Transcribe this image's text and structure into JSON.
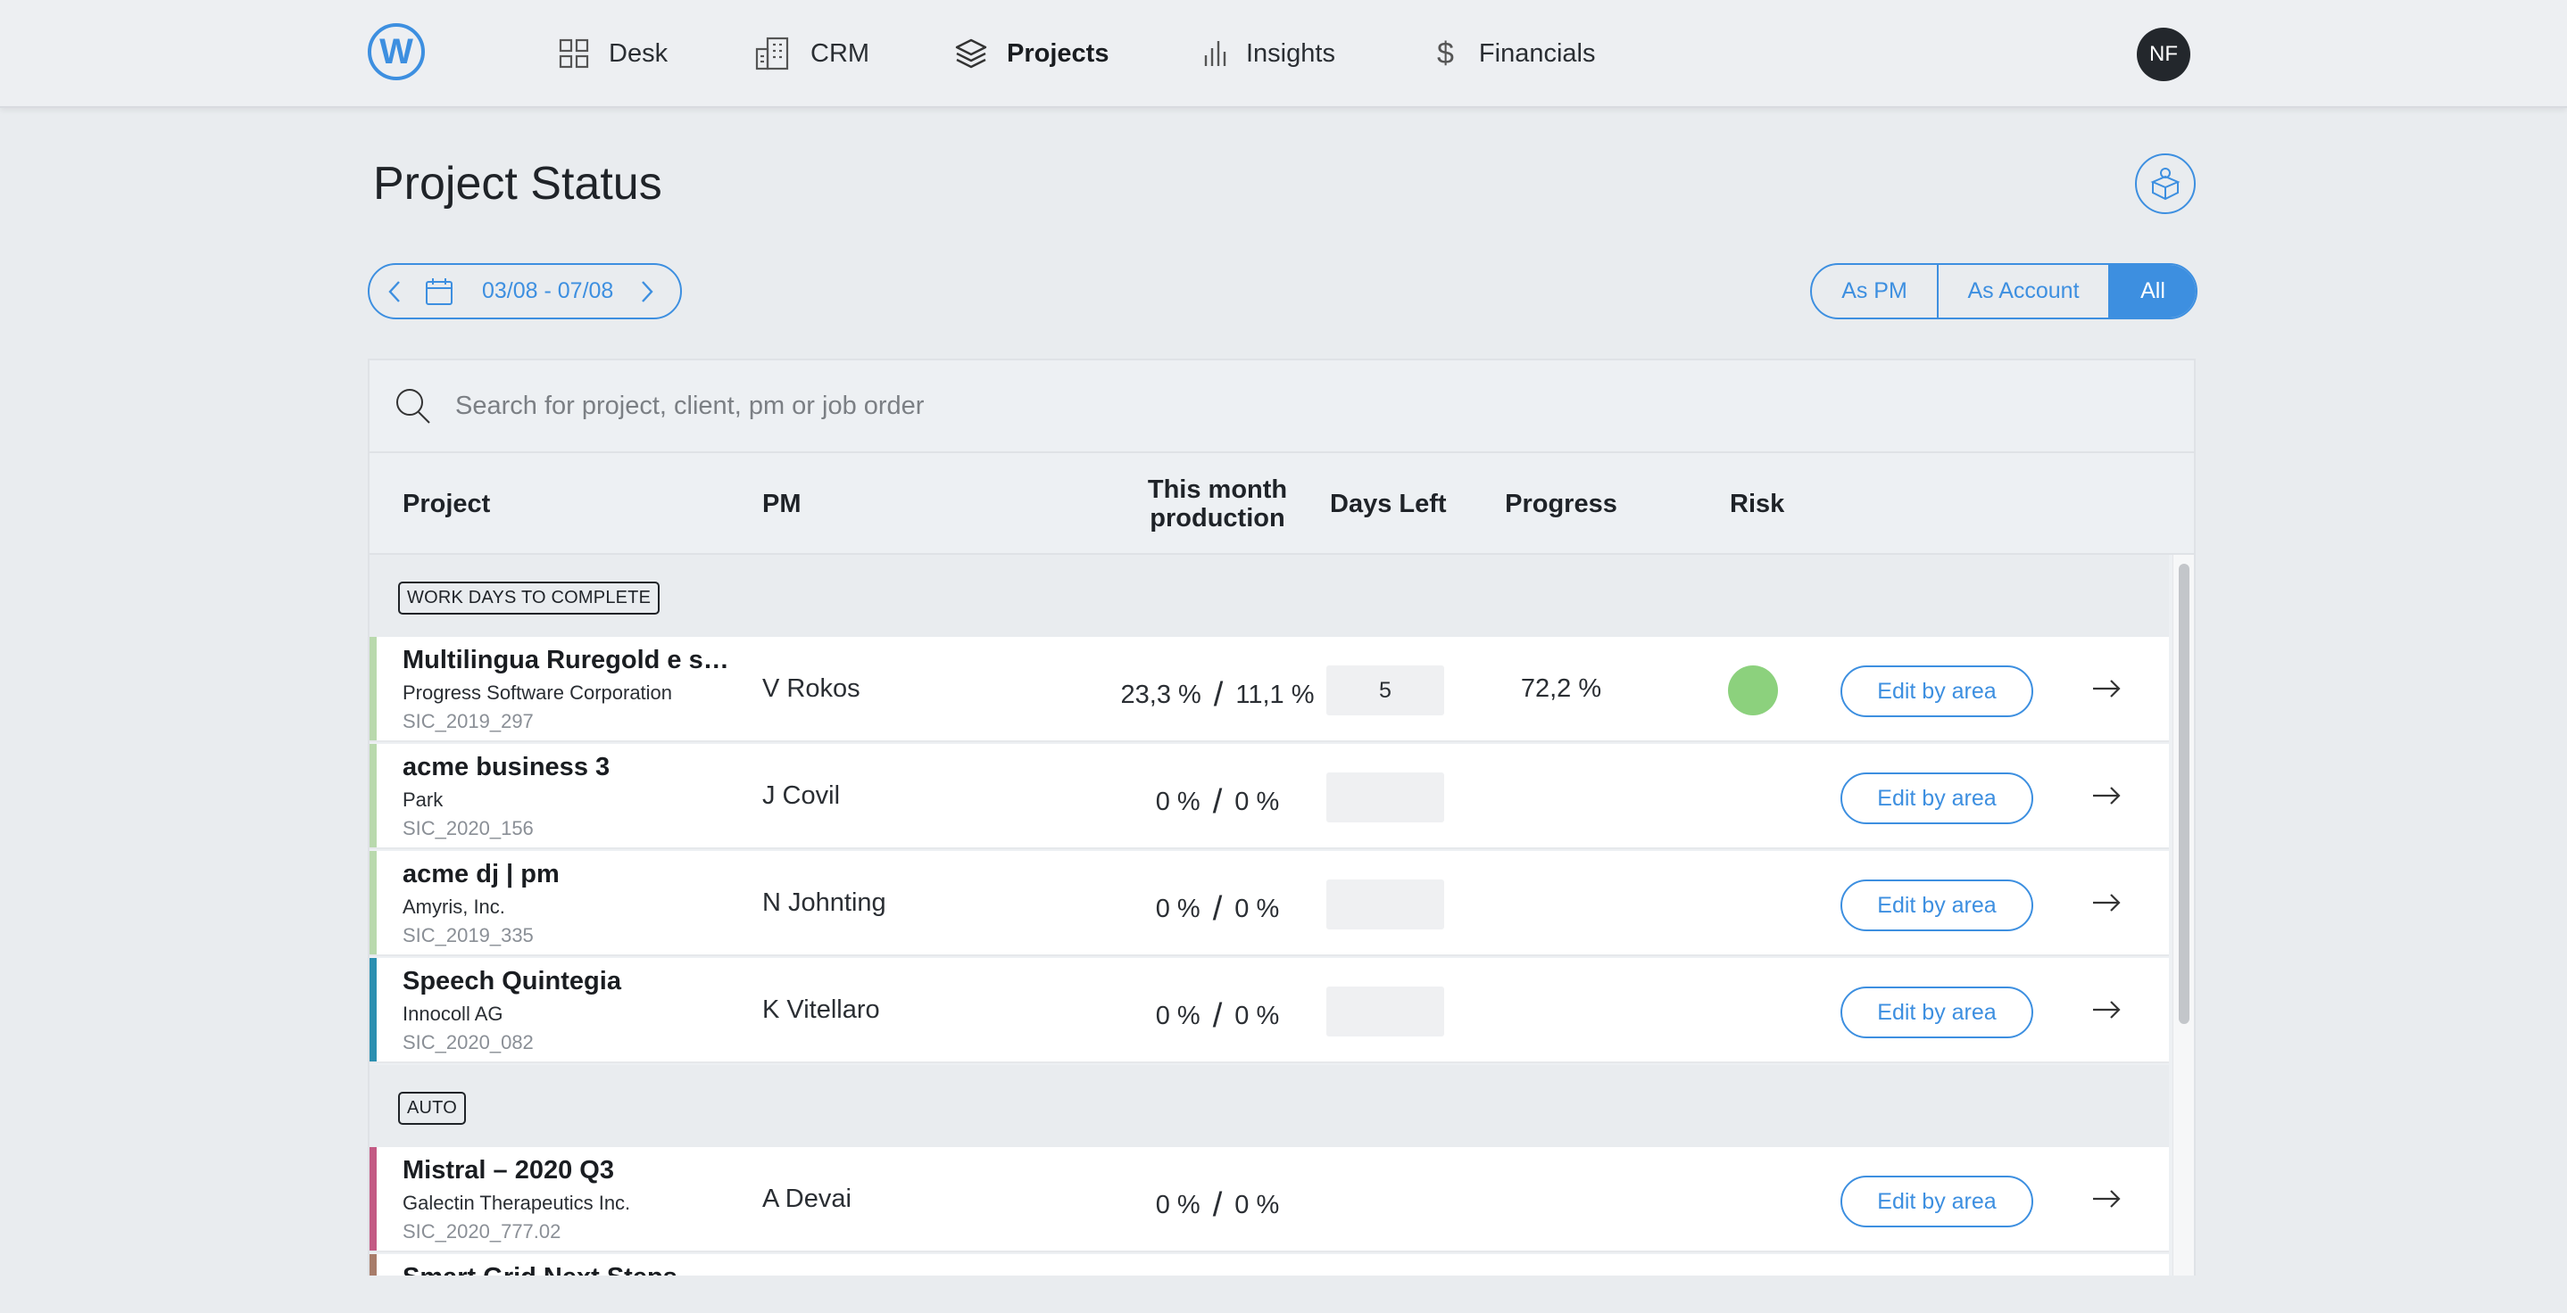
{
  "nav": {
    "logo_letter": "W",
    "items": [
      {
        "label": "Desk",
        "icon": "grid-icon",
        "active": false
      },
      {
        "label": "CRM",
        "icon": "building-icon",
        "active": false
      },
      {
        "label": "Projects",
        "icon": "layers-icon",
        "active": true
      },
      {
        "label": "Insights",
        "icon": "bar-chart-icon",
        "active": false
      },
      {
        "label": "Financials",
        "icon": "dollar-icon",
        "active": false
      }
    ],
    "avatar_initials": "NF"
  },
  "page": {
    "title": "Project Status",
    "date_range": "03/08 - 07/08",
    "filters": [
      {
        "label": "As PM",
        "active": false
      },
      {
        "label": "As Account",
        "active": false
      },
      {
        "label": "All",
        "active": true
      }
    ]
  },
  "search": {
    "placeholder": "Search for project, client, pm or job order"
  },
  "table": {
    "columns": {
      "project": "Project",
      "pm": "PM",
      "production_line1": "This month",
      "production_line2": "production",
      "days_left": "Days Left",
      "progress": "Progress",
      "risk": "Risk"
    },
    "groups": [
      {
        "tag": "WORK DAYS TO COMPLETE",
        "rows": [
          {
            "project": "Multilingua Ruregold e su...",
            "client": "Progress Software Corporation",
            "code": "SIC_2019_297",
            "pm": "V Rokos",
            "prod_a": "23,3 %",
            "prod_b": "11,1 %",
            "days_left": "5",
            "progress": "72,2 %",
            "risk_color": "#8cd17d",
            "bar_color": "#b9d9ad",
            "action": "Edit by area"
          },
          {
            "project": "acme business 3",
            "client": "Park",
            "code": "SIC_2020_156",
            "pm": "J Covil",
            "prod_a": "0 %",
            "prod_b": "0 %",
            "days_left": "",
            "progress": "",
            "risk_color": "",
            "bar_color": "#b9d9ad",
            "action": "Edit by area"
          },
          {
            "project": "acme dj | pm",
            "client": "Amyris, Inc.",
            "code": "SIC_2019_335",
            "pm": "N Johnting",
            "prod_a": "0 %",
            "prod_b": "0 %",
            "days_left": "",
            "progress": "",
            "risk_color": "",
            "bar_color": "#b9d9ad",
            "action": "Edit by area"
          },
          {
            "project": "Speech Quintegia",
            "client": "Innocoll AG",
            "code": "SIC_2020_082",
            "pm": "K Vitellaro",
            "prod_a": "0 %",
            "prod_b": "0 %",
            "days_left": "",
            "progress": "",
            "risk_color": "",
            "bar_color": "#2b8fb0",
            "action": "Edit by area"
          }
        ]
      },
      {
        "tag": "AUTO",
        "rows": [
          {
            "project": "Mistral – 2020 Q3",
            "client": "Galectin Therapeutics Inc.",
            "code": "SIC_2020_777.02",
            "pm": "A Devai",
            "prod_a": "0 %",
            "prod_b": "0 %",
            "days_left": "",
            "progress": "",
            "risk_color": "",
            "bar_color": "#c35a84",
            "action": "Edit by area"
          },
          {
            "project": "Smart Grid Next Steps",
            "client": "",
            "code": "",
            "pm": "",
            "prod_a": "",
            "prod_b": "",
            "days_left": "",
            "progress": "",
            "risk_color": "",
            "bar_color": "#a87c6a",
            "action": ""
          }
        ]
      }
    ]
  },
  "colors": {
    "accent": "#3d8fe0",
    "risk_low": "#8cd17d"
  }
}
